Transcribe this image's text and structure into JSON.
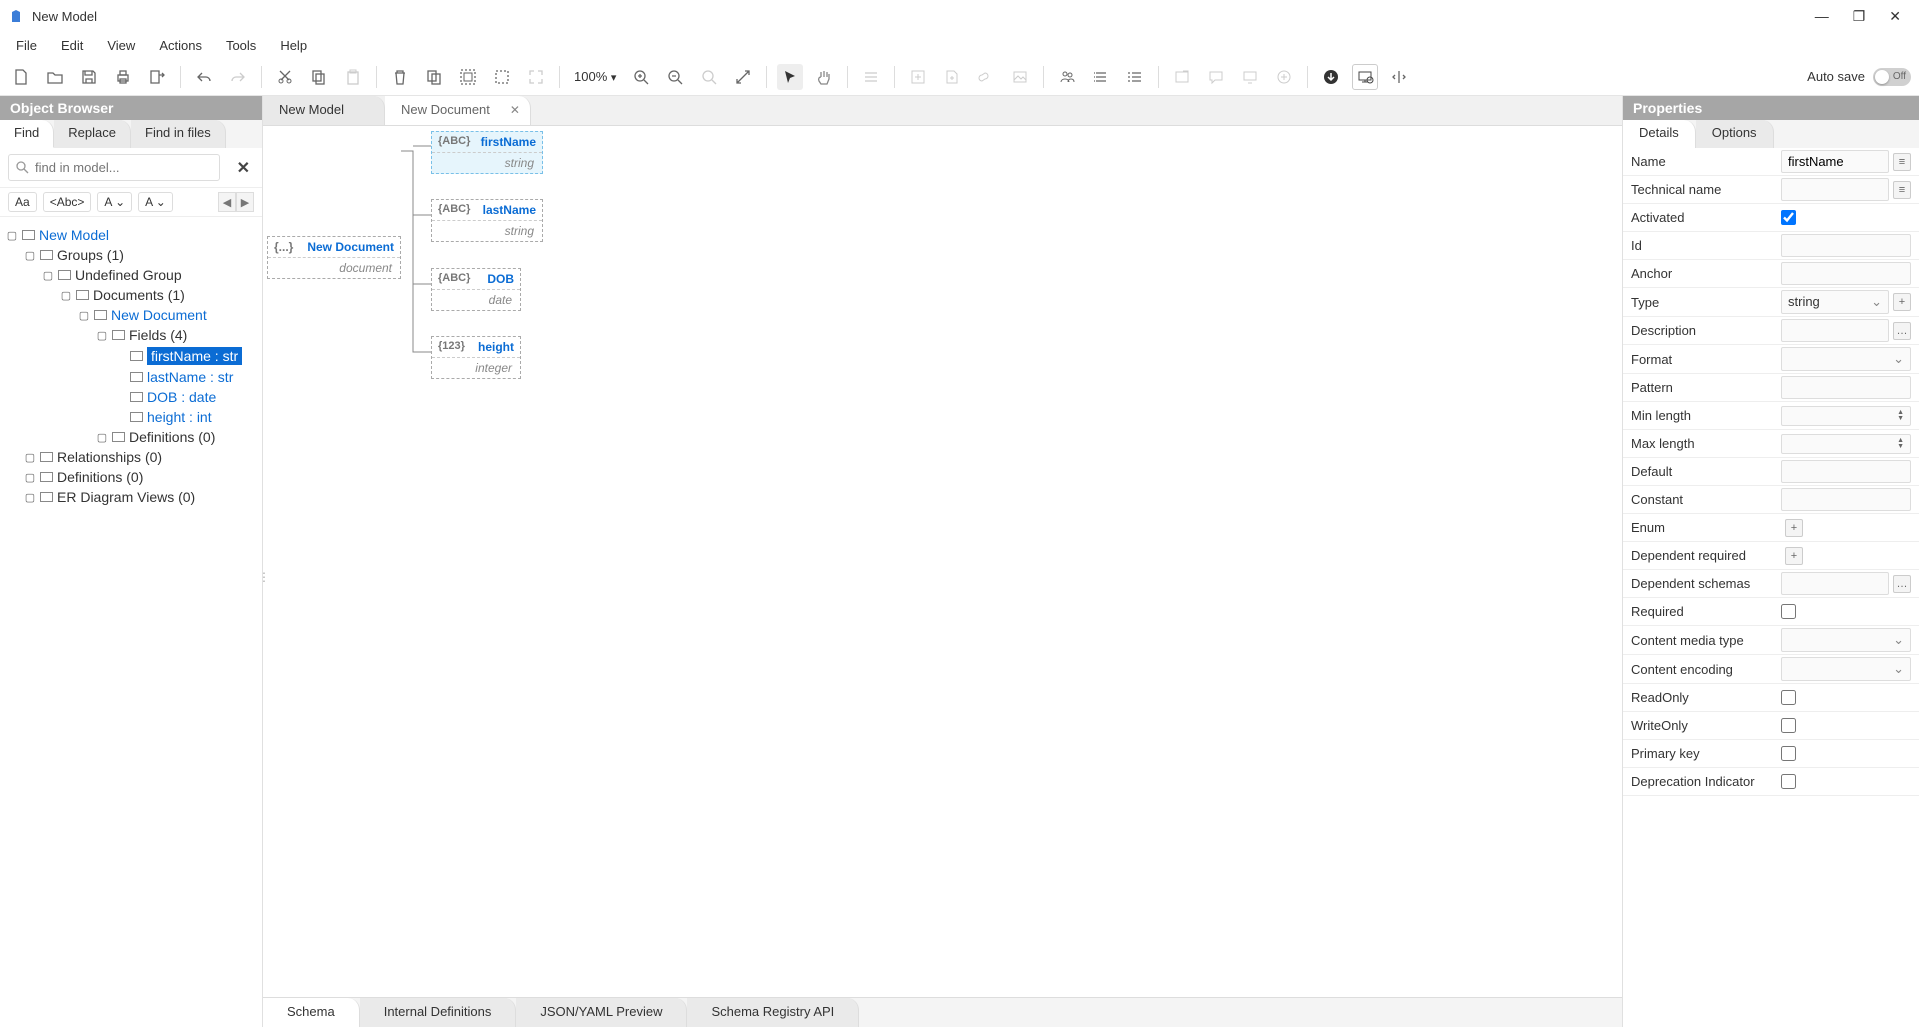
{
  "title": "New Model",
  "menubar": [
    "File",
    "Edit",
    "View",
    "Actions",
    "Tools",
    "Help"
  ],
  "toolbar": {
    "zoom": "100%",
    "autosave_label": "Auto save",
    "autosave_state": "Off"
  },
  "left": {
    "header": "Object Browser",
    "tabs": [
      "Find",
      "Replace",
      "Find in files"
    ],
    "active_tab": 0,
    "search_placeholder": "find in model...",
    "options": [
      "Aa",
      "<Abc>",
      "A ⌄",
      "A ⌄"
    ],
    "tree": {
      "root": "New Model",
      "groups": "Groups (1)",
      "ugrp": "Undefined Group",
      "docs": "Documents (1)",
      "newdoc": "New Document",
      "fields": "Fields (4)",
      "field_items": [
        {
          "label": "firstName : str",
          "selected": true
        },
        {
          "label": "lastName : str",
          "selected": false
        },
        {
          "label": "DOB : date",
          "selected": false
        },
        {
          "label": "height : int",
          "selected": false
        }
      ],
      "defs": "Definitions (0)",
      "rels": "Relationships (0)",
      "defs2": "Definitions (0)",
      "erd": "ER Diagram Views (0)"
    }
  },
  "center": {
    "tabs": [
      {
        "label": "New Model",
        "active": false,
        "closable": false
      },
      {
        "label": "New Document",
        "active": true,
        "closable": true
      }
    ],
    "root_node": {
      "tag": "{...}",
      "name": "New Document",
      "type": "document"
    },
    "fields": [
      {
        "tag": "{ABC}",
        "name": "firstName",
        "type": "string",
        "selected": true
      },
      {
        "tag": "{ABC}",
        "name": "lastName",
        "type": "string",
        "selected": false
      },
      {
        "tag": "{ABC}",
        "name": "DOB",
        "type": "date",
        "selected": false,
        "narrow": true
      },
      {
        "tag": "{123}",
        "name": "height",
        "type": "integer",
        "selected": false,
        "narrow": true
      }
    ],
    "bottom_tabs": [
      "Schema",
      "Internal Definitions",
      "JSON/YAML Preview",
      "Schema Registry API"
    ],
    "active_bottom": 0
  },
  "right": {
    "header": "Properties",
    "tabs": [
      "Details",
      "Options"
    ],
    "active_tab": 0,
    "props": [
      {
        "label": "Name",
        "type": "text",
        "value": "firstName",
        "ext": "menu"
      },
      {
        "label": "Technical name",
        "type": "text",
        "value": "",
        "ext": "menu"
      },
      {
        "label": "Activated",
        "type": "checkbox",
        "value": true
      },
      {
        "label": "Id",
        "type": "text",
        "value": ""
      },
      {
        "label": "Anchor",
        "type": "text",
        "value": ""
      },
      {
        "label": "Type",
        "type": "dropdown",
        "value": "string",
        "ext": "plus"
      },
      {
        "label": "Description",
        "type": "text",
        "value": "",
        "ext": "dots"
      },
      {
        "label": "Format",
        "type": "dropdown",
        "value": ""
      },
      {
        "label": "Pattern",
        "type": "text",
        "value": ""
      },
      {
        "label": "Min length",
        "type": "number",
        "value": ""
      },
      {
        "label": "Max length",
        "type": "number",
        "value": ""
      },
      {
        "label": "Default",
        "type": "text",
        "value": ""
      },
      {
        "label": "Constant",
        "type": "text",
        "value": ""
      },
      {
        "label": "Enum",
        "type": "button",
        "value": "+"
      },
      {
        "label": "Dependent required",
        "type": "button",
        "value": "+"
      },
      {
        "label": "Dependent schemas",
        "type": "text",
        "value": "",
        "ext": "dots"
      },
      {
        "label": "Required",
        "type": "checkbox",
        "value": false
      },
      {
        "label": "Content media type",
        "type": "dropdown",
        "value": ""
      },
      {
        "label": "Content encoding",
        "type": "dropdown",
        "value": ""
      },
      {
        "label": "ReadOnly",
        "type": "checkbox",
        "value": false
      },
      {
        "label": "WriteOnly",
        "type": "checkbox",
        "value": false
      },
      {
        "label": "Primary key",
        "type": "checkbox",
        "value": false
      },
      {
        "label": "Deprecation Indicator",
        "type": "checkbox",
        "value": false
      }
    ]
  }
}
